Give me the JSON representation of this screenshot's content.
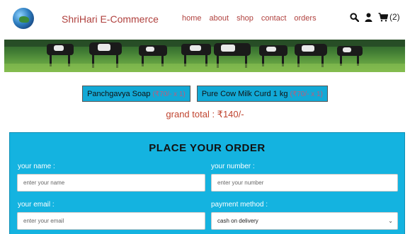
{
  "header": {
    "brand": "ShriHari E-Commerce",
    "nav": [
      "home",
      "about",
      "shop",
      "contact",
      "orders"
    ],
    "cart_count": "(2)",
    "icons": [
      "logo-icon",
      "search-icon",
      "user-icon",
      "cart-icon"
    ]
  },
  "banner": {
    "alt": "cows grazing on a green pasture"
  },
  "order_items": [
    {
      "name": "Panchgavya Soap",
      "price": "(₹70/- x 1)"
    },
    {
      "name": "Pure Cow Milk Curd 1 kg",
      "price": "(₹70/- x 1)"
    }
  ],
  "grand_total": "grand total : ₹140/-",
  "form": {
    "title": "PLACE YOUR ORDER",
    "name_label": "your name :",
    "name_placeholder": "enter your name",
    "number_label": "your number :",
    "number_placeholder": "enter your number",
    "email_label": "your email :",
    "email_placeholder": "enter your email",
    "payment_label": "payment method :",
    "payment_selected": "cash on delivery"
  },
  "colors": {
    "brand_red": "#b0413e",
    "panel_blue": "#14b3e0",
    "chip_blue": "#12a9d6",
    "grand_total": "#c0442f"
  }
}
